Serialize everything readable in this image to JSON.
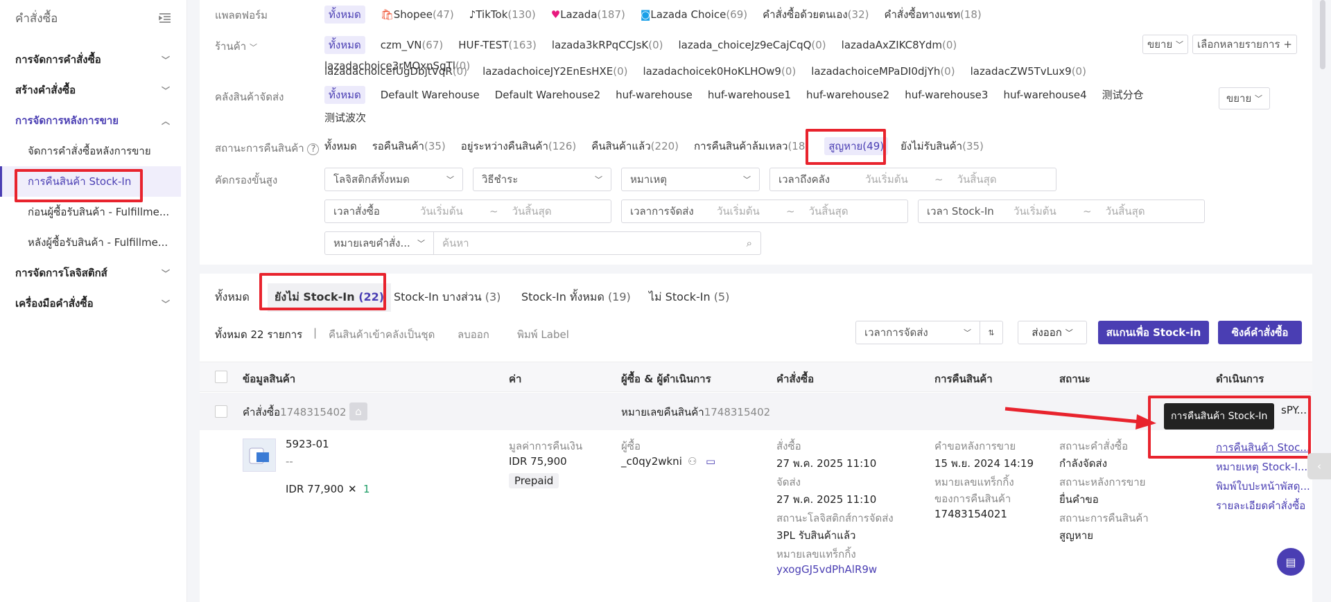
{
  "sidebar": {
    "title": "คำสั่งซื้อ",
    "groups": [
      {
        "label": "การจัดการคำสั่งซื้อ"
      },
      {
        "label": "สร้างคำสั่งซื้อ"
      },
      {
        "label": "การจัดการหลังการขาย"
      },
      {
        "label": "การจัดการโลจิสติกส์"
      },
      {
        "label": "เครื่องมือคำสั่งซื้อ"
      }
    ],
    "subs": [
      {
        "label": "จัดการคำสั่งซื้อหลังการขาย"
      },
      {
        "label": "การคืนสินค้า Stock-In"
      },
      {
        "label": "ก่อนผู้ซื้อรับสินค้า - Fulfillme..."
      },
      {
        "label": "หลังผู้ซื้อรับสินค้า - Fulfillme..."
      }
    ]
  },
  "filters": {
    "platform_label": "แพลตฟอร์ม",
    "platforms": [
      {
        "label": "ทั้งหมด",
        "count": ""
      },
      {
        "label": "Shopee",
        "count": "(47)"
      },
      {
        "label": "TikTok",
        "count": "(130)"
      },
      {
        "label": "Lazada",
        "count": "(187)"
      },
      {
        "label": "Lazada Choice",
        "count": "(69)"
      },
      {
        "label": "คำสั่งซื้อด้วยตนเอง",
        "count": "(32)"
      },
      {
        "label": "คำสั่งซื้อทางแชท",
        "count": "(18)"
      }
    ],
    "shop_label": "ร้านค้า",
    "shops_row1": [
      {
        "label": "ทั้งหมด",
        "count": ""
      },
      {
        "label": "czm_VN",
        "count": "(67)"
      },
      {
        "label": "HUF-TEST",
        "count": "(163)"
      },
      {
        "label": "lazada3kRPqCCJsK",
        "count": "(0)"
      },
      {
        "label": "lazada_choiceJz9eCajCqQ",
        "count": "(0)"
      },
      {
        "label": "lazadaAxZIKC8Ydm",
        "count": "(0)"
      },
      {
        "label": "lazadachoice3rMOxnSqTl",
        "count": "(0)"
      }
    ],
    "shops_row2": [
      {
        "label": "lazadachoicefUgDbjtVqR",
        "count": "(0)"
      },
      {
        "label": "lazadachoiceJY2EnEsHXE",
        "count": "(0)"
      },
      {
        "label": "lazadachoicek0HoKLHOw9",
        "count": "(0)"
      },
      {
        "label": "lazadachoiceMPaDI0djYh",
        "count": "(0)"
      },
      {
        "label": "lazadacZW5TvLux9",
        "count": "(0)"
      }
    ],
    "expand_label": "ขยาย",
    "multi_select_label": "เลือกหลายรายการ",
    "warehouse_label": "คลังสินค้าจัดส่ง",
    "warehouses_row1": [
      "ทั้งหมด",
      "Default Warehouse",
      "Default Warehouse2",
      "huf-warehouse",
      "huf-warehouse1",
      "huf-warehouse2",
      "huf-warehouse3",
      "huf-warehouse4",
      "测试分仓"
    ],
    "warehouses_row2": [
      "测试波次"
    ],
    "return_status_label": "สถานะการคืนสินค้า",
    "return_statuses": [
      {
        "label": "ทั้งหมด",
        "count": ""
      },
      {
        "label": "รอคืนสินค้า",
        "count": "(35)"
      },
      {
        "label": "อยู่ระหว่างคืนสินค้า",
        "count": "(126)"
      },
      {
        "label": "คืนสินค้าแล้ว",
        "count": "(220)"
      },
      {
        "label": "การคืนสินค้าล้มเหลว",
        "count": "(18)"
      },
      {
        "label": "สูญหาย",
        "count": "(49)"
      },
      {
        "label": "ยังไม่รับสินค้า",
        "count": "(35)"
      }
    ],
    "advanced_label": "คัดกรองขั้นสูง",
    "logistics_select": "โลจิสติกส์ทั้งหมด",
    "payment_select": "วิธีชำระ",
    "reason_select": "หมาเหตุ",
    "date_to_warehouse": "เวลาถึงคลัง",
    "date_order": "เวลาสั่งซื้อ",
    "date_shipping": "เวลาการจัดส่ง",
    "date_stockin": "เวลา Stock-In",
    "start_ph": "วันเริ่มต้น",
    "end_ph": "วันสิ้นสุด",
    "tilde": "~",
    "search_type": "หมายเลขคำสั่ง...",
    "search_ph": "ค้นหา"
  },
  "tabs": [
    {
      "label": "ทั้งหมด",
      "count": ""
    },
    {
      "label": "ยังไม่ Stock-In",
      "count": "(22)"
    },
    {
      "label": "Stock-In บางส่วน",
      "count": "(3)"
    },
    {
      "label": "Stock-In ทั้งหมด",
      "count": "(19)"
    },
    {
      "label": "ไม่ Stock-In",
      "count": "(5)"
    }
  ],
  "toolbar": {
    "total": "ทั้งหมด 22 รายการ",
    "sep": "|",
    "bundle": "คืนสินค้าเข้าคลังเป็นชุด",
    "delete": "ลบออก",
    "print": "พิมพ์ Label",
    "sort_select": "เวลาการจัดส่ง",
    "export": "ส่งออก",
    "scan": "สแกนเพื่อ Stock-in",
    "sync": "ซิงค์คำสั่งซื้อ"
  },
  "table": {
    "headers": [
      "ข้อมูลสินค้า",
      "ค่า",
      "ผู้ซื้อ & ผู้ดำเนินการ",
      "คำสั่งซื้อ",
      "การคืนสินค้า",
      "สถานะ",
      "ดำเนินการ"
    ],
    "order_label": "คำสั่งซื้อ",
    "order_no": "1748315402",
    "return_no_label": "หมายเลขคืนสินค้า",
    "return_no": "1748315402",
    "partial_id": "sPY...",
    "product": {
      "sku": "5923-01",
      "variant": "--",
      "price": "IDR 77,900",
      "times": "✕",
      "qty": "1"
    },
    "value": {
      "label": "มูลค่าการคืนเงิน",
      "amount": "IDR 75,900",
      "tag": "Prepaid"
    },
    "buyer": {
      "label": "ผู้ซื้อ",
      "name": "_c0qy2wkni"
    },
    "order": {
      "ordered_label": "สั่งซื้อ",
      "ordered": "27 พ.ค. 2025 11:10",
      "shipped_label": "จัดส่ง",
      "shipped": "27 พ.ค. 2025 11:10",
      "logistics_label": "สถานะโลจิสติกส์การจัดส่ง",
      "logistics": "3PL รับสินค้าแล้ว",
      "tracking_label": "หมายเลขแทร็กกิ้ง",
      "tracking": "yxogGJ5vdPhAlR9w"
    },
    "ret": {
      "req_label": "คำขอหลังการขาย",
      "req": "15 พ.ย. 2024 14:19",
      "track_label1": "หมายเลขแทร็กกิ้ง",
      "track_label2": "ของการคืนสินค้า",
      "track": "17483154021"
    },
    "status": {
      "order_label": "สถานะคำสั่งซื้อ",
      "order": "กำลังจัดส่ง",
      "after_label": "สถานะหลังการขาย",
      "after": "ยื่นคำขอ",
      "return_label": "สถานะการคืนสินค้า",
      "ret": "สูญหาย"
    },
    "actions": [
      "การคืนสินค้า Stoc...",
      "หมายเหตุ Stock-I...",
      "พิมพ์ใบปะหน้าพัสดุ...",
      "รายละเอียดคำสั่งซื้อ"
    ]
  },
  "tooltip": "การคืนสินค้า Stock-In",
  "colors": {
    "accent": "#4a3eb3",
    "highlight": "#e8232d"
  }
}
